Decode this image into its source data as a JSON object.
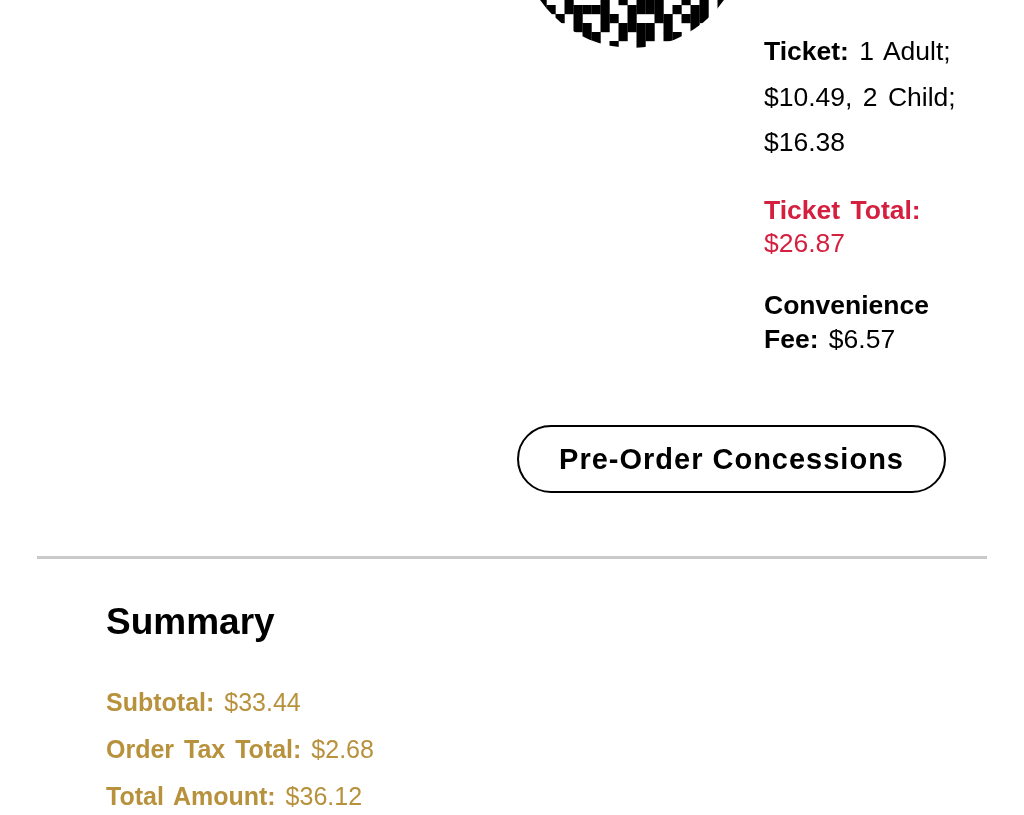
{
  "ticket_details": [
    {
      "kind": "breakdown",
      "label": "Ticket:",
      "value": "1 Adult; $10.49, 2 Child; $16.38"
    },
    {
      "kind": "total",
      "label": "Ticket Total:",
      "value": "$26.87"
    },
    {
      "kind": "fee",
      "label": "Convenience Fee:",
      "value": "$6.57"
    }
  ],
  "action_button": {
    "label": "Pre-Order Concessions"
  },
  "summary": {
    "title": "Summary",
    "lines": [
      {
        "label": "Subtotal:",
        "value": "$33.44"
      },
      {
        "label": "Order Tax Total:",
        "value": "$2.68"
      },
      {
        "label": "Total Amount:",
        "value": "$36.12"
      }
    ]
  }
}
